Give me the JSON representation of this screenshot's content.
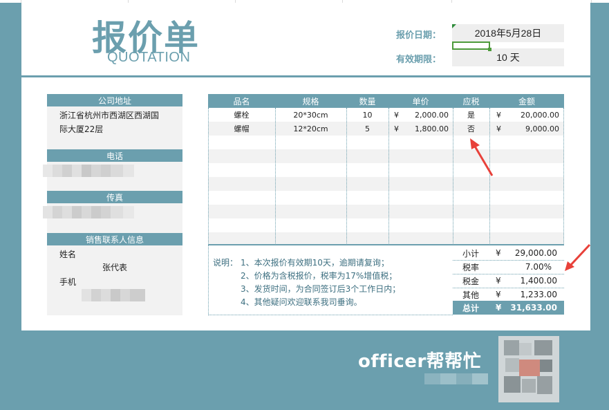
{
  "title": "报价单",
  "subtitle": "QUOTATION",
  "meta": {
    "date_label": "报价日期：",
    "date_value": "2018年5月28日",
    "validity_label": "有效期限：",
    "validity_value": "10 天"
  },
  "left_panel": {
    "address_header": "公司地址",
    "address_line1": "浙江省杭州市西湖区西湖国",
    "address_line2": "际大厦22层",
    "phone_header": "电话",
    "fax_header": "传真",
    "contact_header": "销售联系人信息",
    "name_label": "姓名",
    "name_value": "张代表",
    "mobile_label": "手机"
  },
  "table": {
    "headers": [
      "品名",
      "规格",
      "数量",
      "单价",
      "应税",
      "金额"
    ],
    "rows": [
      {
        "name": "螺栓",
        "spec": "20*30cm",
        "qty": "10",
        "currency": "¥",
        "price": "2,000.00",
        "taxable": "是",
        "amount_currency": "¥",
        "amount": "20,000.00"
      },
      {
        "name": "螺帽",
        "spec": "12*20cm",
        "qty": "5",
        "currency": "¥",
        "price": "1,800.00",
        "taxable": "否",
        "amount_currency": "¥",
        "amount": "9,000.00"
      }
    ]
  },
  "notes": {
    "prefix": "说明：",
    "lines": [
      "1、本次报价有效期10天，逾期请复询；",
      "2、价格为含税报价，税率为17%增值税；",
      "3、发货时间，为合同签订后3个工作日内；",
      "4、其他疑问欢迎联系我司垂询。"
    ]
  },
  "summary": {
    "subtotal_label": "小计",
    "subtotal_currency": "¥",
    "subtotal_value": "29,000.00",
    "tax_rate_label": "税率",
    "tax_rate_value": "7.00%",
    "tax_label": "税金",
    "tax_currency": "¥",
    "tax_value": "1,400.00",
    "other_label": "其他",
    "other_currency": "¥",
    "other_value": "1,233.00",
    "total_label": "总计",
    "total_currency": "¥",
    "total_value": "31,633.00"
  },
  "brand": "officer帮帮忙",
  "colors": {
    "accent": "#6b9fae",
    "panel_bg": "#f2f2f2",
    "row_alt": "#f2f2f2",
    "arrow": "#e8413a",
    "note_text": "#3d6f80"
  }
}
